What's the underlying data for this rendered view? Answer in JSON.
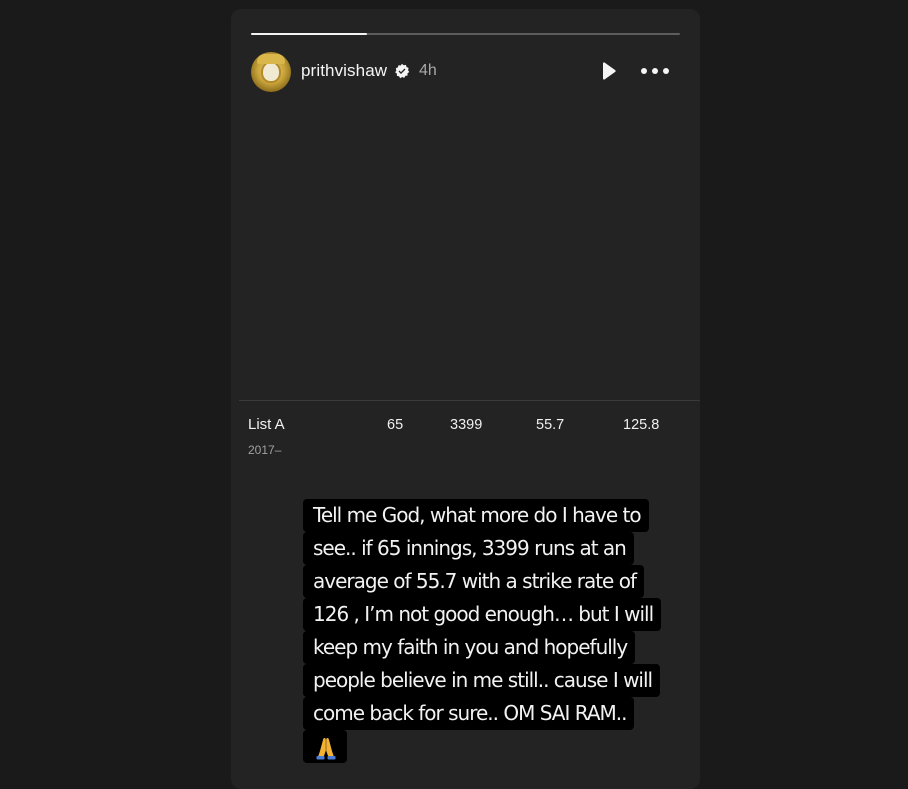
{
  "story": {
    "progress": 0.27,
    "username": "prithvishaw",
    "timestamp": "4h",
    "controls": {
      "play_icon": "play-icon",
      "more_icon": "more-options-icon"
    }
  },
  "stats": {
    "format": "List A",
    "years": "2017–",
    "innings": "65",
    "runs": "3399",
    "average": "55.7",
    "strike_rate": "125.8"
  },
  "caption": {
    "lines": [
      "Tell me God, what more do I have to",
      "see.. if 65 innings, 3399 runs at an",
      "average of 55.7 with a strike rate of",
      "126 , I’m not good enough… but I will",
      "keep my faith in you and hopefully",
      "people believe in me still.. cause I will",
      "come back for sure.. OM SAI RAM.."
    ],
    "emoji": "🙏"
  },
  "colors": {
    "background": "#1a1a1a",
    "card": "#232323",
    "caption_bg": "#000000"
  }
}
